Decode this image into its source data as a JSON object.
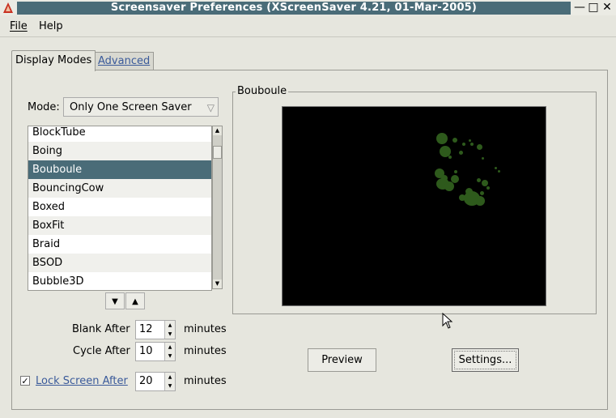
{
  "window": {
    "title": "Screensaver Preferences  (XScreenSaver 4.21, 01-Mar-2005)",
    "buttons": [
      "—",
      "□",
      "✕"
    ]
  },
  "menu": {
    "file": "File",
    "help": "Help"
  },
  "tabs": {
    "display_modes": "Display Modes",
    "advanced": "Advanced"
  },
  "mode": {
    "label": "Mode:",
    "value": "Only One Screen Saver"
  },
  "screensavers": [
    "BlockTube",
    "Boing",
    "Bouboule",
    "BouncingCow",
    "Boxed",
    "BoxFit",
    "Braid",
    "BSOD",
    "Bubble3D"
  ],
  "selected_screensaver": "Bouboule",
  "blank_after": {
    "label": "Blank After",
    "value": "12",
    "unit": "minutes"
  },
  "cycle_after": {
    "label": "Cycle After",
    "value": "10",
    "unit": "minutes"
  },
  "lock_after": {
    "label": "Lock Screen After",
    "value": "20",
    "unit": "minutes",
    "checked": true
  },
  "preview": {
    "legend": "Bouboule",
    "preview_button": "Preview",
    "settings_button": "Settings..."
  },
  "colors": {
    "title_bar": "#4a6c78",
    "selection": "#4a6c78",
    "ball": "#2e5a1c"
  }
}
